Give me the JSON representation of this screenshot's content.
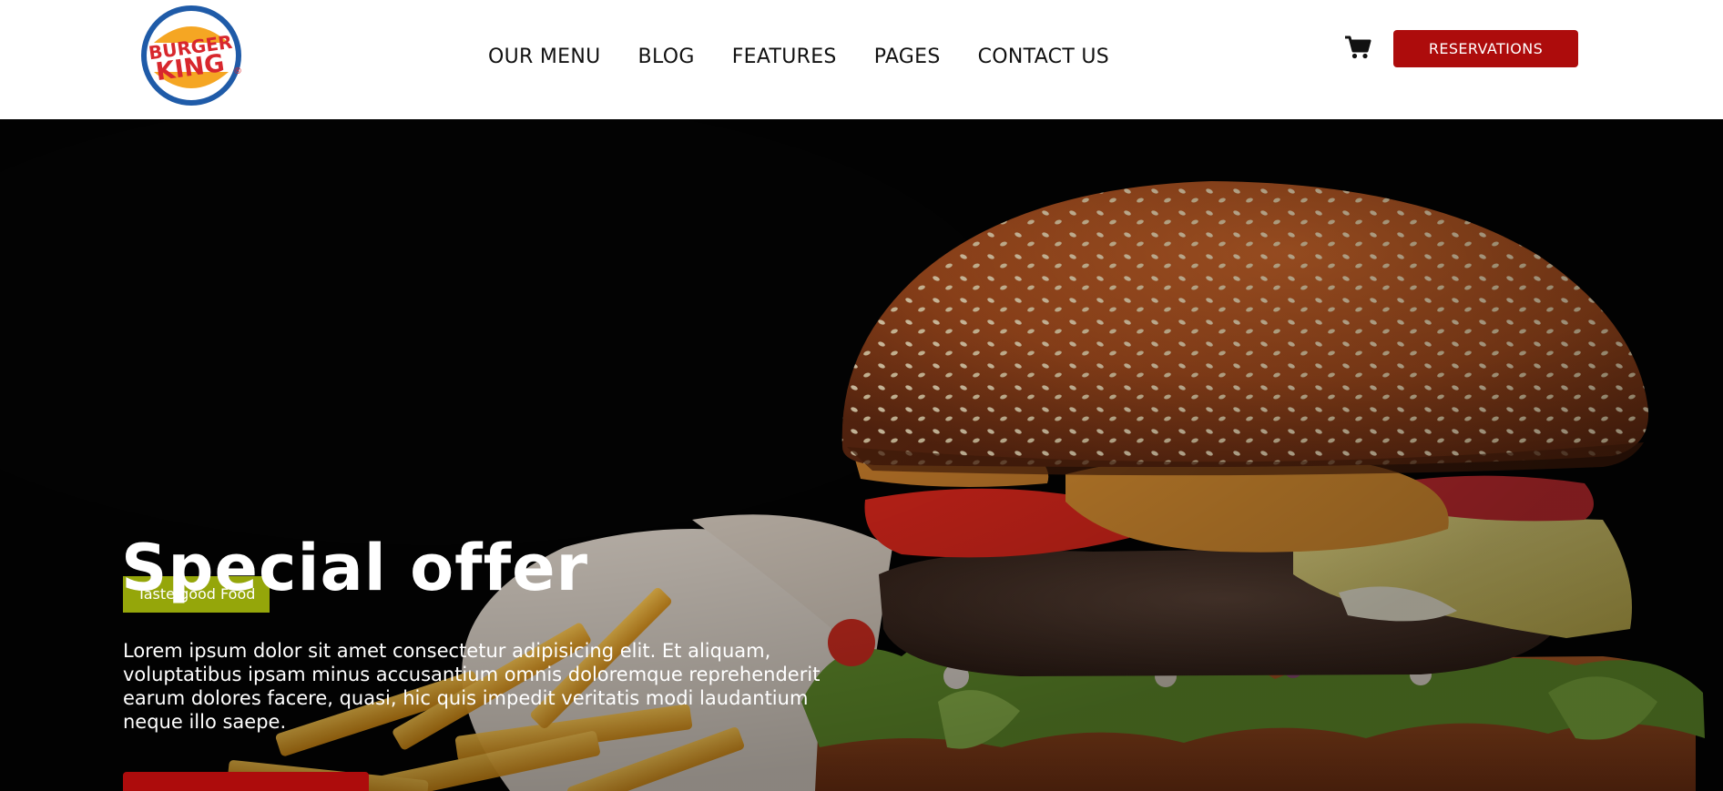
{
  "brand": {
    "logo_text": [
      "BURGER",
      "KING"
    ],
    "registered": "®"
  },
  "nav": {
    "items": [
      "OUR MENU",
      "BLOG",
      "FEATURES",
      "PAGES",
      "CONTACT US"
    ]
  },
  "header": {
    "cart_icon": "cart-icon",
    "reservations_label": "RESERVATIONS"
  },
  "hero": {
    "tag": "Taste good Food",
    "title": "Special offer",
    "text": "Lorem ipsum dolor sit amet consectetur adipisicing elit. Et aliquam, voluptatibus ipsam minus accusantium omnis doloremque reprehenderit earum dolores facere, quasi, hic quis impedit veritatis modi laudantium neque illo saepe."
  },
  "colors": {
    "accent": "#ad0c0c",
    "tag": "#95a60a",
    "logo_blue": "#1f5ba8",
    "logo_orange": "#f5a623",
    "logo_red": "#d8272d"
  }
}
